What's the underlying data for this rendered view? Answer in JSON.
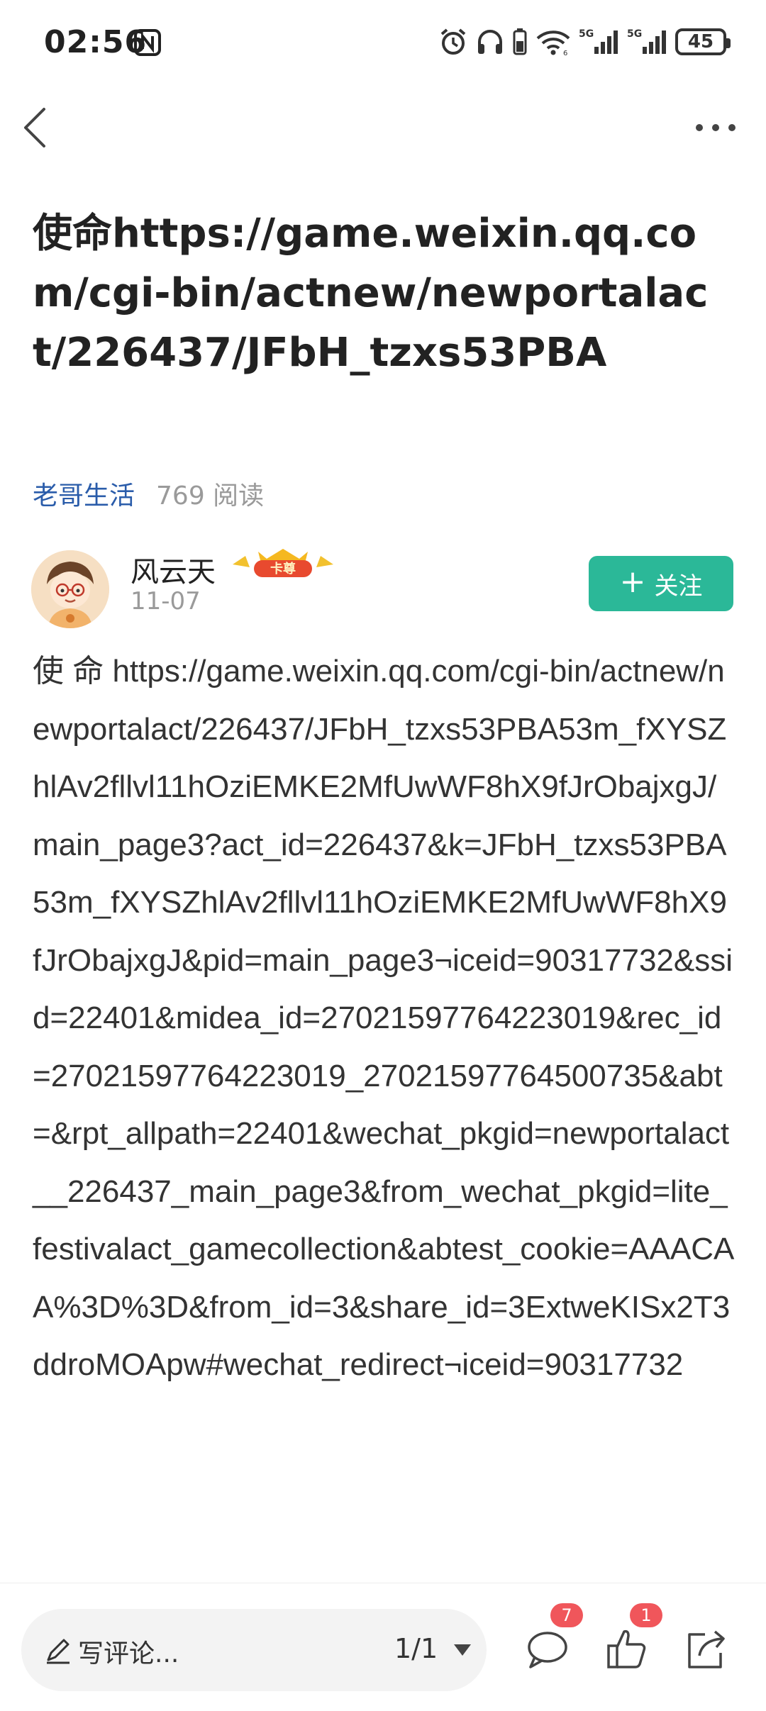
{
  "status": {
    "time": "02:56",
    "battery": "45"
  },
  "article": {
    "title": "使命https://game.weixin.qq.com/cgi-bin/actnew/newportalact/226437/JFbH_tzxs53PBA",
    "source": "老哥生活",
    "reads": "769 阅读",
    "body": "使 命 https://game.weixin.qq.com/cgi-bin/actnew/newportalact/226437/JFbH_tzxs53PBA53m_fXYSZhlAv2fllvl11hOziEMKE2MfUwWF8hX9fJrObajxgJ/main_page3?act_id=226437&k=JFbH_tzxs53PBA53m_fXYSZhlAv2fllvl11hOziEMKE2MfUwWF8hX9fJrObajxgJ&pid=main_page3¬iceid=90317732&ssid=22401&midea_id=27021597764223019&rec_id=27021597764223019_27021597764500735&abt=&rpt_allpath=22401&wechat_pkgid=newportalact__226437_main_page3&from_wechat_pkgid=lite_festivalact_gamecollection&abtest_cookie=AAACAA%3D%3D&from_id=3&share_id=3ExtweKISx2T3ddroMOApw#wechat_redirect¬iceid=90317732"
  },
  "author": {
    "name": "风云天",
    "badge": "卡尊",
    "date": "11-07",
    "follow_label": "关注"
  },
  "bottom_bar": {
    "comment_placeholder": "写评论...",
    "page_indicator": "1/1",
    "comment_count": "7",
    "like_count": "1"
  },
  "colors": {
    "accent_green": "#2bb898",
    "source_blue": "#2a5caa",
    "badge_red": "#f0565b"
  }
}
